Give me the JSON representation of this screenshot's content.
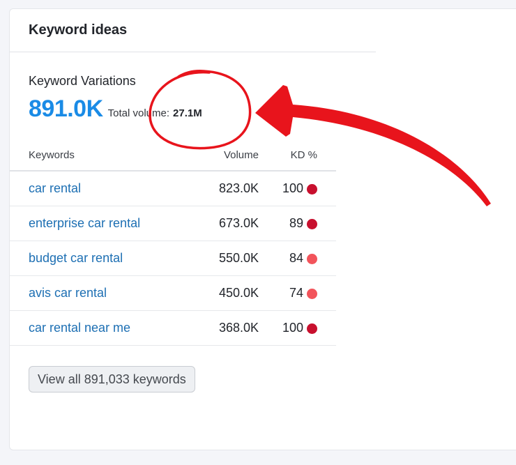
{
  "card": {
    "title": "Keyword ideas"
  },
  "summary": {
    "label": "Keyword Variations",
    "count": "891.0K",
    "total_volume_label": "Total volume:",
    "total_volume_value": "27.1M"
  },
  "table": {
    "headers": {
      "keyword": "Keywords",
      "volume": "Volume",
      "kd": "KD %"
    },
    "rows": [
      {
        "keyword": "car rental",
        "volume": "823.0K",
        "kd": "100",
        "kd_color": "#c8102e"
      },
      {
        "keyword": "enterprise car rental",
        "volume": "673.0K",
        "kd": "89",
        "kd_color": "#c8102e"
      },
      {
        "keyword": "budget car rental",
        "volume": "550.0K",
        "kd": "84",
        "kd_color": "#f2545b"
      },
      {
        "keyword": "avis car rental",
        "volume": "450.0K",
        "kd": "74",
        "kd_color": "#f2545b"
      },
      {
        "keyword": "car rental near me",
        "volume": "368.0K",
        "kd": "100",
        "kd_color": "#c8102e"
      }
    ]
  },
  "view_all": {
    "label": "View all 891,033 keywords"
  },
  "annotation": {
    "color": "#e8141c",
    "shapes": [
      "hand-drawn-circle",
      "hand-drawn-arrow"
    ]
  }
}
